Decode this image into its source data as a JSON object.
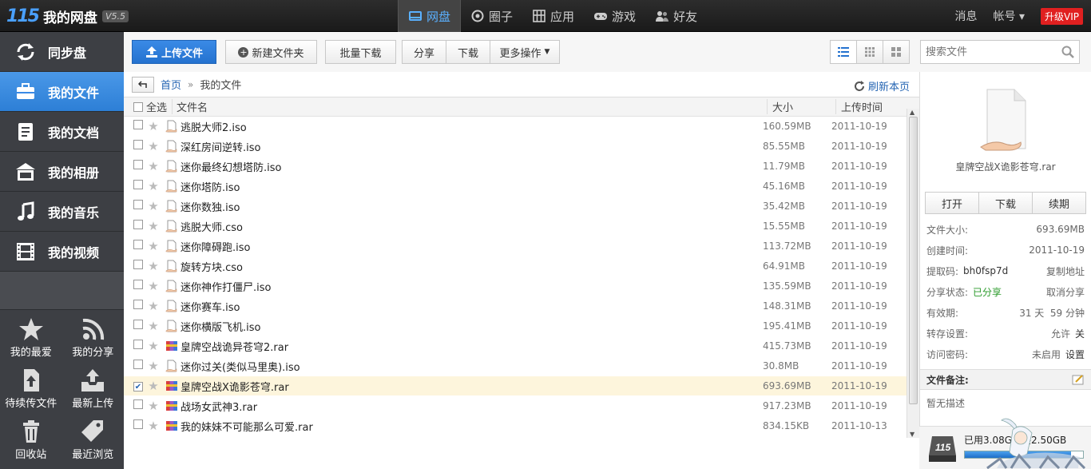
{
  "app": {
    "logo_mark": "115",
    "name": "我的网盘",
    "version": "V5.5"
  },
  "topnav": [
    {
      "label": "网盘",
      "icon": "hdd-icon",
      "active": true
    },
    {
      "label": "圈子",
      "icon": "circle-icon",
      "active": false
    },
    {
      "label": "应用",
      "icon": "apps-icon",
      "active": false
    },
    {
      "label": "游戏",
      "icon": "gamepad-icon",
      "active": false
    },
    {
      "label": "好友",
      "icon": "friends-icon",
      "active": false
    }
  ],
  "topright": {
    "messages": "消息",
    "account": "帐号",
    "vip": "升级VIP"
  },
  "sidebar": {
    "items": [
      {
        "label": "同步盘",
        "icon": "sync-icon"
      },
      {
        "label": "我的文件",
        "icon": "briefcase-icon"
      },
      {
        "label": "我的文档",
        "icon": "document-icon"
      },
      {
        "label": "我的相册",
        "icon": "photo-album-icon"
      },
      {
        "label": "我的音乐",
        "icon": "music-icon"
      },
      {
        "label": "我的视频",
        "icon": "film-icon"
      }
    ],
    "grid": [
      {
        "label": "我的最爱",
        "icon": "star-icon"
      },
      {
        "label": "我的分享",
        "icon": "rss-share-icon"
      },
      {
        "label": "待续传文件",
        "icon": "upload-file-icon"
      },
      {
        "label": "最新上传",
        "icon": "upload-tray-icon"
      },
      {
        "label": "回收站",
        "icon": "trash-icon"
      },
      {
        "label": "最近浏览",
        "icon": "tag-icon"
      }
    ]
  },
  "toolbar": {
    "upload": "上传文件",
    "new_folder": "新建文件夹",
    "batch_download": "批量下载",
    "share": "分享",
    "download": "下载",
    "more": "更多操作"
  },
  "search": {
    "placeholder": "搜索文件"
  },
  "breadcrumb": {
    "home": "首页",
    "sep": "»",
    "current": "我的文件",
    "refresh": "刷新本页"
  },
  "table": {
    "headers": {
      "select_all": "全选",
      "name": "文件名",
      "size": "大小",
      "time": "上传时间"
    },
    "rows": [
      {
        "name": "逃脱大师2.iso",
        "size": "160.59MB",
        "time": "2011-10-19",
        "type": "doc"
      },
      {
        "name": "深红房间逆转.iso",
        "size": "85.55MB",
        "time": "2011-10-19",
        "type": "doc"
      },
      {
        "name": "迷你最终幻想塔防.iso",
        "size": "11.79MB",
        "time": "2011-10-19",
        "type": "doc"
      },
      {
        "name": "迷你塔防.iso",
        "size": "45.16MB",
        "time": "2011-10-19",
        "type": "doc"
      },
      {
        "name": "迷你数独.iso",
        "size": "35.42MB",
        "time": "2011-10-19",
        "type": "doc"
      },
      {
        "name": "逃脱大师.cso",
        "size": "15.55MB",
        "time": "2011-10-19",
        "type": "doc"
      },
      {
        "name": "迷你障碍跑.iso",
        "size": "113.72MB",
        "time": "2011-10-19",
        "type": "doc"
      },
      {
        "name": "旋转方块.cso",
        "size": "64.91MB",
        "time": "2011-10-19",
        "type": "doc"
      },
      {
        "name": "迷你神作打僵尸.iso",
        "size": "135.59MB",
        "time": "2011-10-19",
        "type": "doc"
      },
      {
        "name": "迷你赛车.iso",
        "size": "148.31MB",
        "time": "2011-10-19",
        "type": "doc"
      },
      {
        "name": "迷你横版飞机.iso",
        "size": "195.41MB",
        "time": "2011-10-19",
        "type": "doc"
      },
      {
        "name": "皇牌空战诡异苍穹2.rar",
        "size": "415.73MB",
        "time": "2011-10-19",
        "type": "rar"
      },
      {
        "name": "迷你过关(类似马里奥).iso",
        "size": "30.8MB",
        "time": "2011-10-19",
        "type": "doc"
      },
      {
        "name": "皇牌空战X诡影苍穹.rar",
        "size": "693.69MB",
        "time": "2011-10-19",
        "type": "rar",
        "selected": true
      },
      {
        "name": "战场女武神3.rar",
        "size": "917.23MB",
        "time": "2011-10-19",
        "type": "rar"
      },
      {
        "name": "我的妹妹不可能那么可爱.rar",
        "size": "834.15KB",
        "time": "2011-10-13",
        "type": "rar"
      }
    ]
  },
  "detail": {
    "file_name": "皇牌空战X诡影苍穹.rar",
    "actions": {
      "open": "打开",
      "download": "下载",
      "renew": "续期"
    },
    "size_label": "文件大小:",
    "size_value": "693.69MB",
    "created_label": "创建时间:",
    "created_value": "2011-10-19",
    "code_label": "提取码:",
    "code_value": "bh0fsp7d",
    "copy_link": "复制地址",
    "share_label": "分享状态:",
    "share_value": "已分享",
    "cancel_share": "取消分享",
    "valid_label": "有效期:",
    "valid_value": "31 天  59 分钟",
    "transfer_label": "转存设置:",
    "transfer_allow": "允许",
    "transfer_close": "关",
    "password_label": "访问密码:",
    "password_value": "未启用",
    "password_set": "设置",
    "notes_label": "文件备注:",
    "notes_value": "暂无描述"
  },
  "storage": {
    "text": "已用3.08G，共2.50GB",
    "used_fraction": 0.9
  },
  "colors": {
    "accent": "#2d7fd6",
    "vip": "#e02020",
    "link": "#2565b3",
    "selected_row": "#fdf5dc"
  }
}
